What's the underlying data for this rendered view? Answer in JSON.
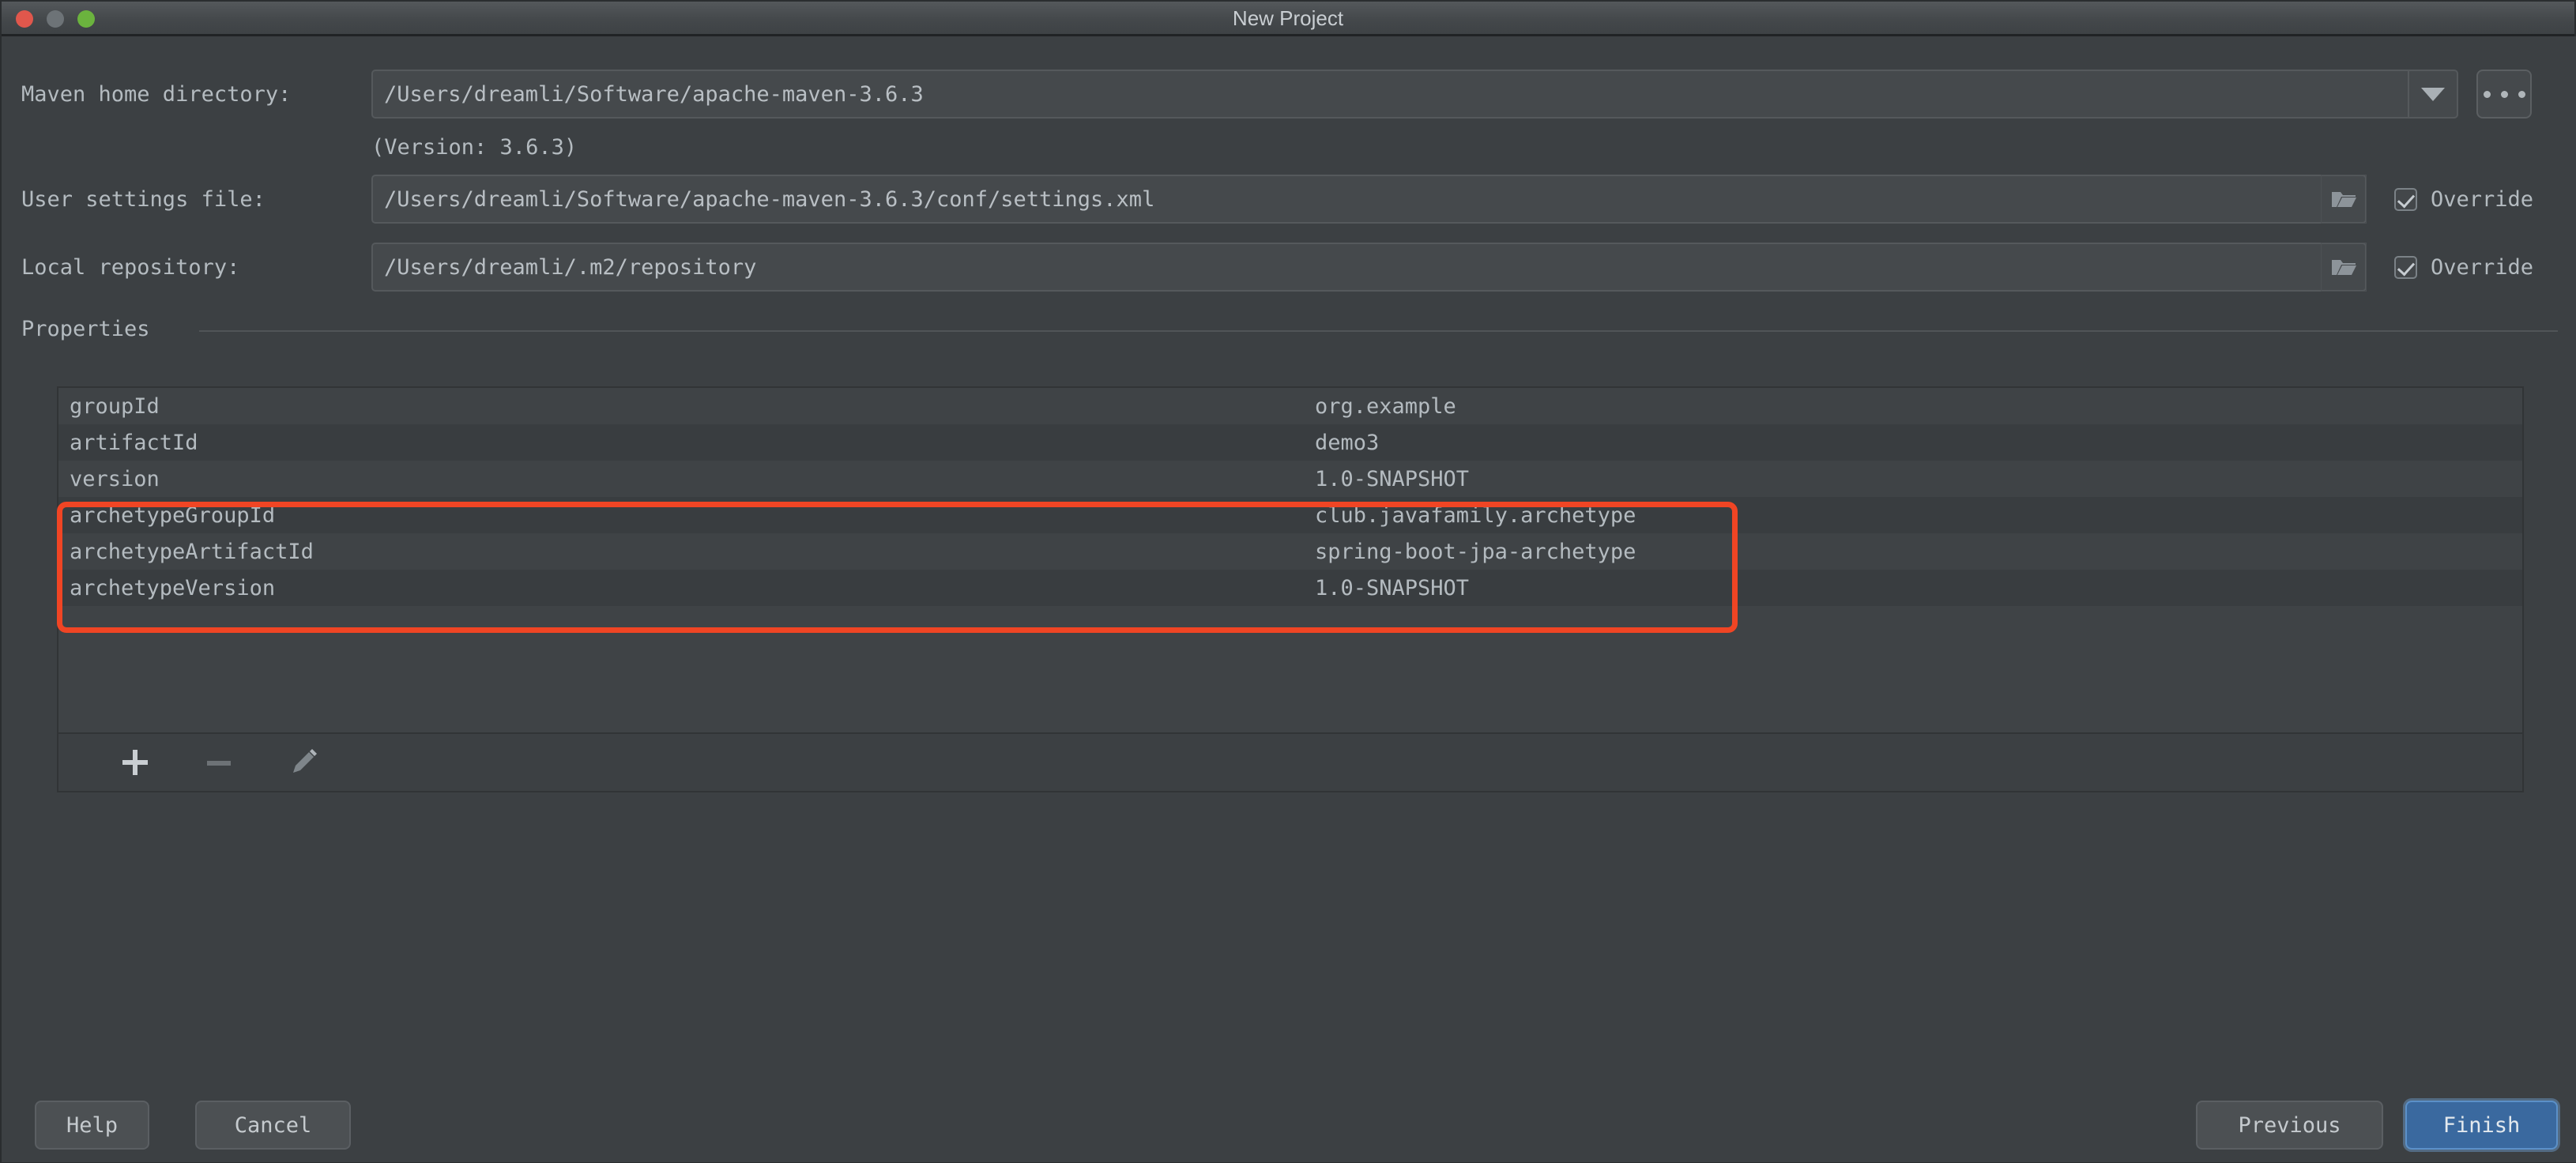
{
  "window": {
    "title": "New Project",
    "traffic_lights": [
      {
        "name": "close",
        "color": "#e0574c"
      },
      {
        "name": "minimize",
        "color": "#6d7377"
      },
      {
        "name": "maximize",
        "color": "#6bb33e"
      }
    ]
  },
  "form": {
    "maven_home": {
      "label": "Maven home directory:",
      "value": "/Users/dreamli/Software/apache-maven-3.6.3",
      "version_note": "(Version: 3.6.3)",
      "browse_label": "..."
    },
    "user_settings": {
      "label": "User settings file:",
      "value": "/Users/dreamli/Software/apache-maven-3.6.3/conf/settings.xml",
      "override_label": "Override",
      "override_checked": true
    },
    "local_repository": {
      "label": "Local repository:",
      "value": "/Users/dreamli/.m2/repository",
      "override_label": "Override",
      "override_checked": true
    }
  },
  "properties": {
    "section_label": "Properties",
    "rows": [
      {
        "key": "groupId",
        "value": "org.example"
      },
      {
        "key": "artifactId",
        "value": "demo3"
      },
      {
        "key": "version",
        "value": "1.0-SNAPSHOT"
      },
      {
        "key": "archetypeGroupId",
        "value": "club.javafamily.archetype"
      },
      {
        "key": "archetypeArtifactId",
        "value": "spring-boot-jpa-archetype"
      },
      {
        "key": "archetypeVersion",
        "value": "1.0-SNAPSHOT"
      }
    ],
    "toolbar": {
      "add": "add-property",
      "remove": "remove-property",
      "edit": "edit-property"
    },
    "highlight": {
      "color": "#f04524",
      "rows": [
        "archetypeGroupId",
        "archetypeArtifactId",
        "archetypeVersion"
      ]
    }
  },
  "footer": {
    "help": "Help",
    "cancel": "Cancel",
    "previous": "Previous",
    "finish": "Finish"
  }
}
